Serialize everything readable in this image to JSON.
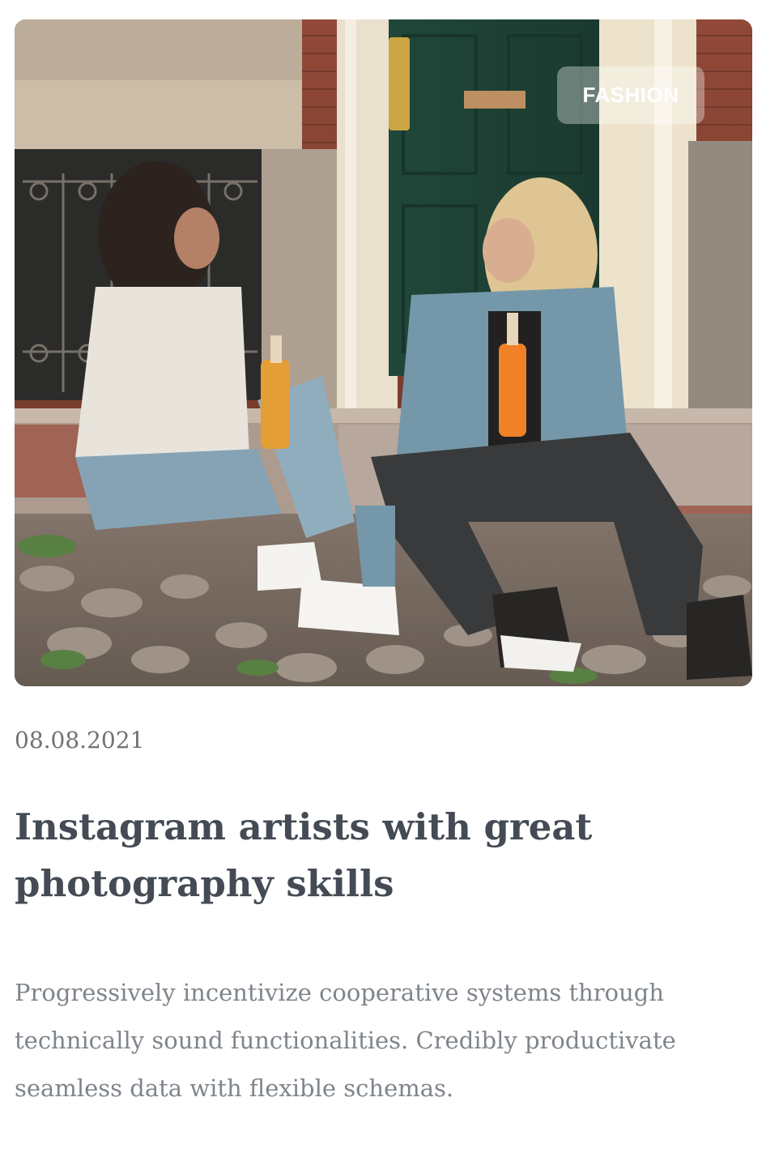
{
  "post": {
    "image_alt": "Two women sitting on a cobblestone street holding orange soda bottles",
    "category": "FASHION",
    "date": "08.08.2021",
    "title": "Instagram artists with great photography skills",
    "excerpt": "Progressively incentivize cooperative systems through technically sound functionalities. Credibly productivate seamless data with flexible schemas."
  },
  "colors": {
    "title": "#444b54",
    "date": "#6f7378",
    "excerpt": "#7f858b",
    "tag_bg": "rgba(255,255,255,0.35)"
  }
}
